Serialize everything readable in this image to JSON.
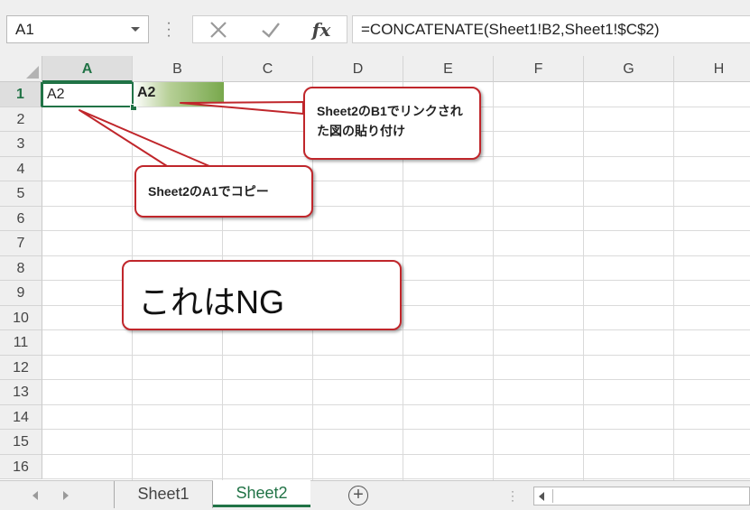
{
  "formula_bar": {
    "name_box": "A1",
    "formula": "=CONCATENATE(Sheet1!B2,Sheet1!$C$2)",
    "fx_label": "fx"
  },
  "grid": {
    "columns": [
      "A",
      "B",
      "C",
      "D",
      "E",
      "F",
      "G",
      "H"
    ],
    "rows": [
      "1",
      "2",
      "3",
      "4",
      "5",
      "6",
      "7",
      "8",
      "9",
      "10",
      "11",
      "12",
      "13",
      "14",
      "15",
      "16"
    ],
    "selected_column": "A",
    "selected_row": "1",
    "cell_a1": "A2",
    "picture_b1": "A2"
  },
  "callouts": {
    "b1_note": "Sheet2のB1でリンクされた図の貼り付け",
    "a1_note": "Sheet2のA1でコピー",
    "ng_note": "これはNG"
  },
  "tabs": {
    "items": [
      "Sheet1",
      "Sheet2"
    ],
    "active": "Sheet2"
  },
  "colors": {
    "accent_green": "#217346",
    "callout_red": "#c0262b"
  },
  "icons": {
    "cancel": "close-icon",
    "enter": "check-icon",
    "function": "fx-icon",
    "add_sheet": "plus-circle-icon"
  }
}
